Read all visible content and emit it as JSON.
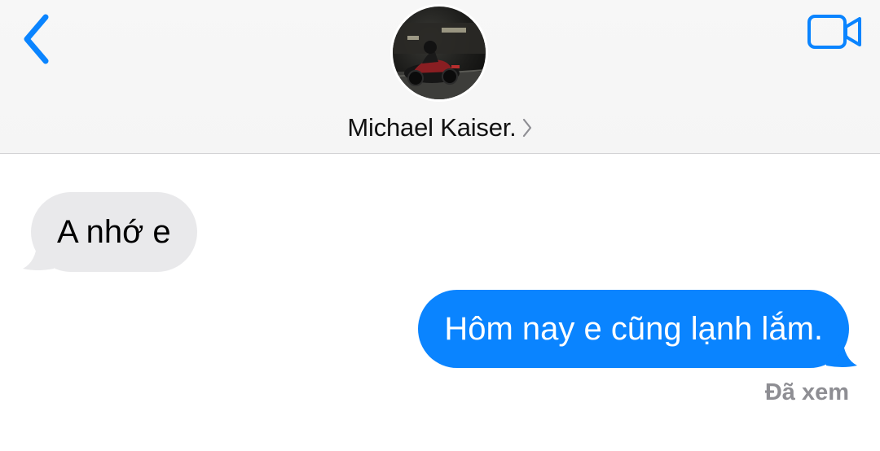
{
  "header": {
    "contact_name": "Michael Kaiser.",
    "accent_color": "#0a84ff"
  },
  "icons": {
    "back": "chevron-left-icon",
    "video": "video-camera-icon",
    "contact_disclosure": "chevron-right-icon"
  },
  "messages": [
    {
      "direction": "incoming",
      "text": "A nhớ e"
    },
    {
      "direction": "outgoing",
      "text": "Hôm nay e cũng lạnh lắm."
    }
  ],
  "status": {
    "read_receipt": "Đã xem"
  },
  "colors": {
    "incoming_bubble": "#e9e9eb",
    "outgoing_bubble": "#0a84ff",
    "receipt_text": "#8e8e93"
  }
}
